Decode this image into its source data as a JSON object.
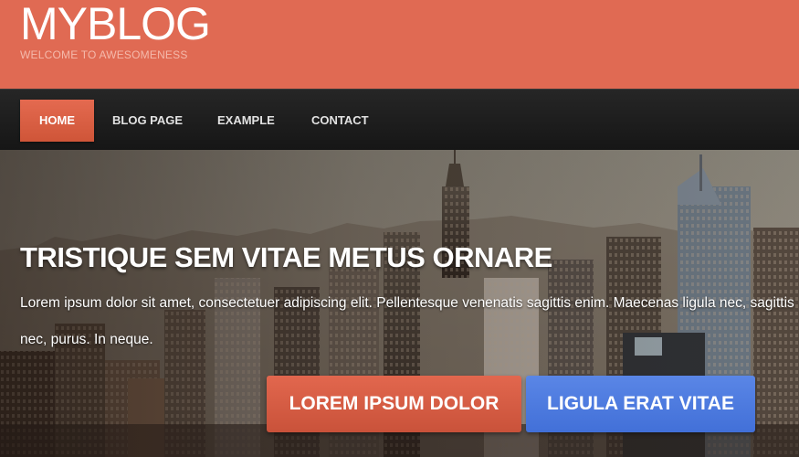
{
  "header": {
    "site_title": "MYBLOG",
    "tagline": "WELCOME TO AWESOMENESS",
    "background_color": "#e06a53"
  },
  "nav": {
    "items": [
      {
        "label": "HOME",
        "active": true
      },
      {
        "label": "BLOG PAGE",
        "active": false
      },
      {
        "label": "EXAMPLE",
        "active": false
      },
      {
        "label": "CONTACT",
        "active": false
      }
    ],
    "active_color": "#d85b40"
  },
  "hero": {
    "title": "TRISTIQUE SEM VITAE METUS ORNARE",
    "text": "Lorem ipsum dolor sit amet, consectetuer adipiscing elit. Pellentesque venenatis sagittis enim. Maecenas ligula nec, sagittis nec, purus. In neque.",
    "primary_button": "LOREM IPSUM DOLOR",
    "secondary_button": "LIGULA ERAT VITAE",
    "primary_color": "#d85b40",
    "secondary_color": "#4f7ce0"
  }
}
